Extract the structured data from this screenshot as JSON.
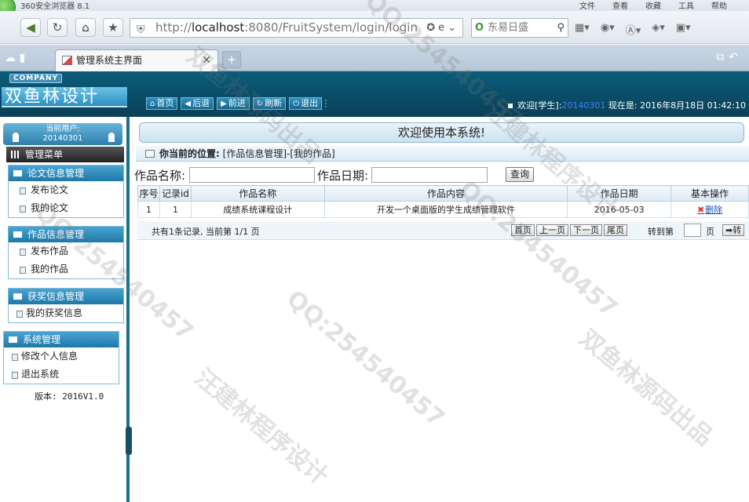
{
  "browser": {
    "app_name": "360安全浏览器 8.1",
    "menu": [
      "文件",
      "查看",
      "收藏",
      "工具",
      "帮助"
    ],
    "url_prefix": "http://",
    "url_host": "localhost",
    "url_rest": ":8080/FruitSystem/login/login",
    "search_text": "东易日盛",
    "tab_title": "管理系统主界面"
  },
  "header": {
    "company": "COMPANY",
    "brand": "双鱼林设计",
    "buttons": [
      "首页",
      "后退",
      "前进",
      "刷新",
      "退出"
    ],
    "welcome_prefix": "欢迎[学生]:",
    "user_id": "20140301",
    "now_label": "现在是: 2016年8月18日 01:42:10"
  },
  "sidebar": {
    "current_user_label": "当前用户:",
    "current_user": "20140301",
    "menu_title": "管理菜单",
    "groups": [
      {
        "title": "论文信息管理",
        "items": [
          "发布论文",
          "我的论文"
        ]
      },
      {
        "title": "作品信息管理",
        "items": [
          "发布作品",
          "我的作品"
        ]
      },
      {
        "title": "获奖信息管理",
        "items": [
          "我的获奖信息"
        ]
      },
      {
        "title": "系统管理",
        "items": [
          "修改个人信息",
          "退出系统"
        ]
      }
    ],
    "version": "版本: 2016V1.0"
  },
  "main": {
    "welcome_title": "欢迎使用本系统!",
    "location_label": "你当前的位置:",
    "location_path": "[作品信息管理]-[我的作品]",
    "filter_name_label": "作品名称:",
    "filter_date_label": "作品日期:",
    "query_button": "查询",
    "columns": [
      "序号",
      "记录id",
      "作品名称",
      "作品内容",
      "作品日期",
      "基本操作"
    ],
    "rows": [
      {
        "seq": "1",
        "id": "1",
        "name": "成绩系统课程设计",
        "content": "开发一个桌面版的学生成绩管理软件",
        "date": "2016-05-03",
        "action": "删除"
      }
    ],
    "pager_info": "共有1条记录, 当前第 1/1 页",
    "pager_buttons": [
      "首页",
      "上一页",
      "下一页",
      "尾页"
    ],
    "goto_label": "转到第",
    "page_unit": "页",
    "go_button": "转"
  },
  "watermarks": [
    "QQ:254540457",
    "双鱼林源码出品",
    "汪建林程序设计"
  ]
}
